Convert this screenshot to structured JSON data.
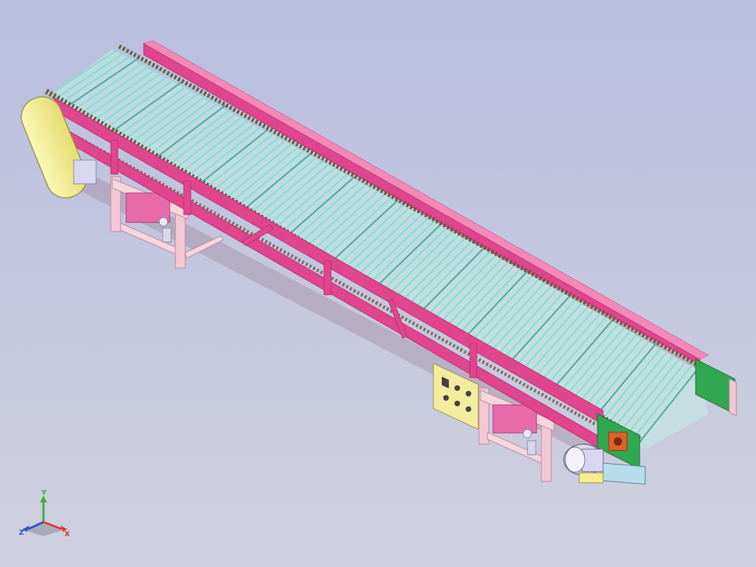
{
  "viewport": {
    "background_top": "#b9bedf",
    "background_bottom": "#cfd0de"
  },
  "model": {
    "name": "",
    "colors": {
      "frame": "#e0458e",
      "frame_dark": "#b8306f",
      "frame_light": "#f28ab7",
      "roller": "#7fe3c9",
      "roller_dark": "#3fb596",
      "chain": "#6b5a3a",
      "support": "#f3c8d4",
      "support_edge": "#b98a97",
      "guard": "#f3ee8c",
      "guard_edge": "#9a9550",
      "panel": "#f2ec9e",
      "end_plate": "#2fa84f",
      "motor": "#d9d6f0",
      "gearbox": "#e0602c",
      "base_plate": "#b9dced"
    },
    "icons": {
      "triad": "view-orientation-triad-icon"
    }
  },
  "triad": {
    "x_label": "X",
    "y_label": "Y",
    "z_label": "Z",
    "x_color": "#e0342d",
    "y_color": "#3fae3a",
    "z_color": "#2f4fd6"
  }
}
